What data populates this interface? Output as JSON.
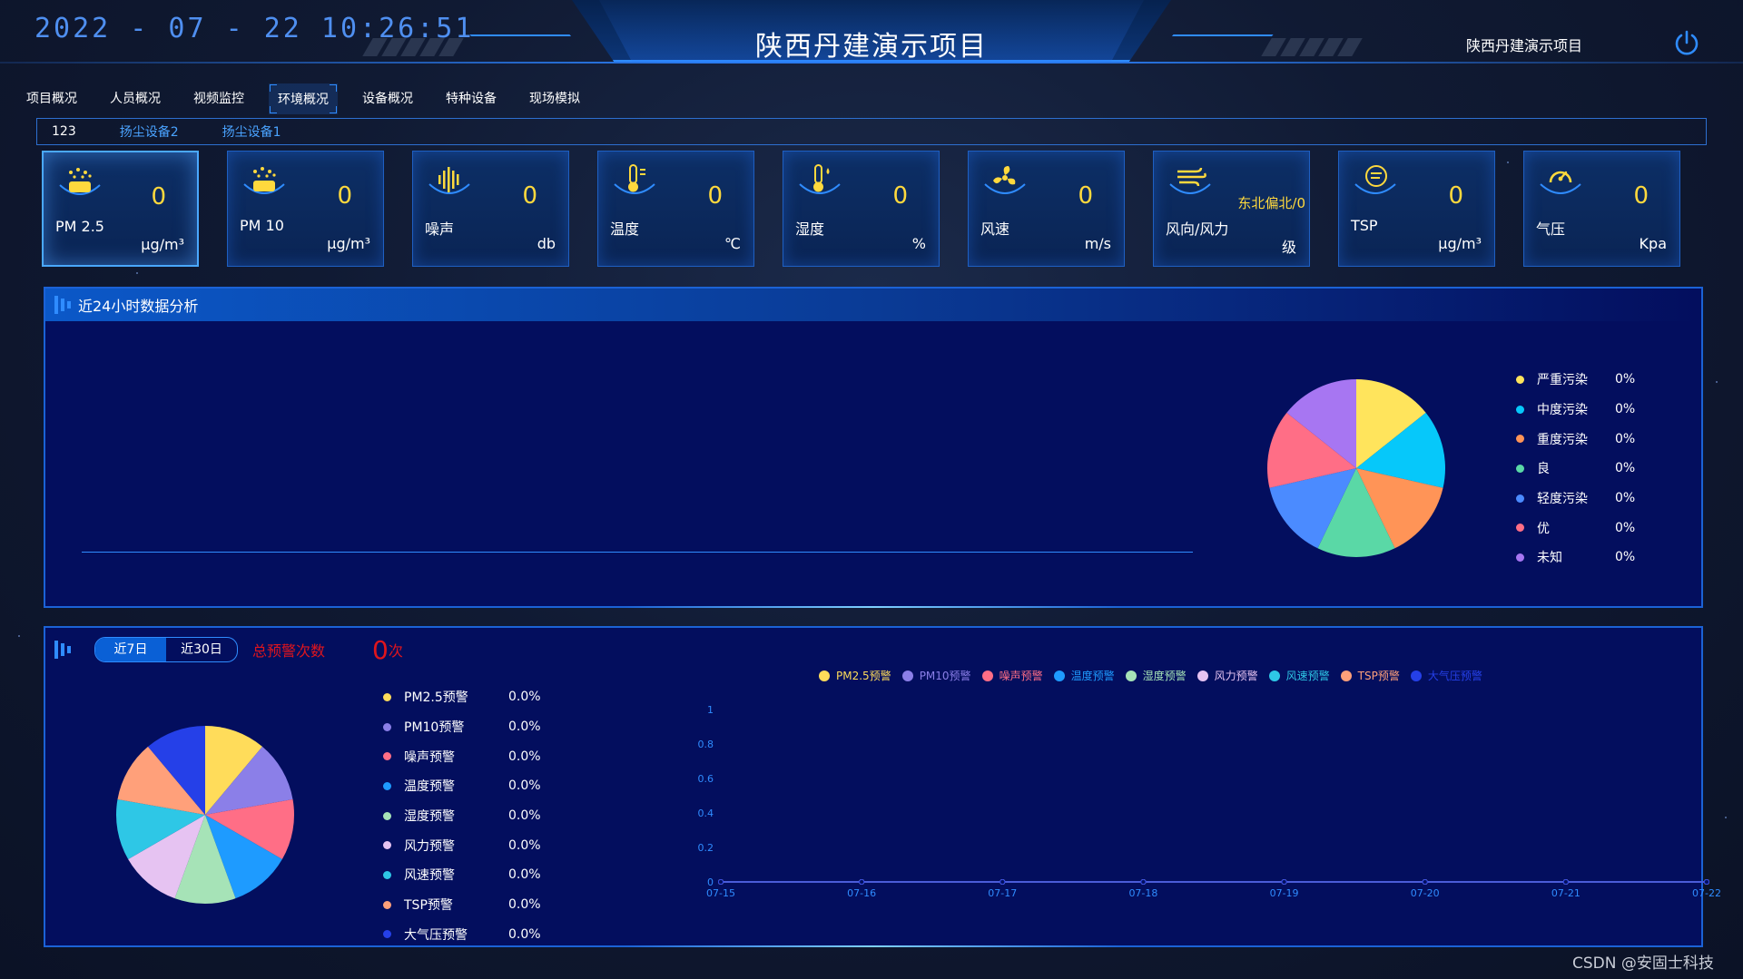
{
  "header": {
    "datetime": "2022 - 07 - 22 10:26:51",
    "title": "陕西丹建演示项目",
    "project_name": "陕西丹建演示项目",
    "power_icon": "power-icon"
  },
  "nav": {
    "items": [
      {
        "label": "项目概况"
      },
      {
        "label": "人员概况"
      },
      {
        "label": "视频监控"
      },
      {
        "label": "环境概况",
        "active": true
      },
      {
        "label": "设备概况"
      },
      {
        "label": "特种设备"
      },
      {
        "label": "现场模拟"
      }
    ]
  },
  "device_tabs": [
    {
      "label": "123",
      "active": true
    },
    {
      "label": "扬尘设备2"
    },
    {
      "label": "扬尘设备1"
    }
  ],
  "cards": [
    {
      "label": "PM 2.5",
      "value": "0",
      "unit": "μg/m³",
      "icon": "pm25-icon"
    },
    {
      "label": "PM 10",
      "value": "0",
      "unit": "μg/m³",
      "icon": "pm10-icon"
    },
    {
      "label": "噪声",
      "value": "0",
      "unit": "db",
      "icon": "noise-icon"
    },
    {
      "label": "温度",
      "value": "0",
      "unit": "℃",
      "icon": "thermometer-icon"
    },
    {
      "label": "湿度",
      "value": "0",
      "unit": "%",
      "icon": "humidity-icon"
    },
    {
      "label": "风速",
      "value": "0",
      "unit": "m/s",
      "icon": "fan-icon"
    },
    {
      "label": "风向/风力",
      "value": "东北偏北/0",
      "unit": "级",
      "icon": "wind-icon"
    },
    {
      "label": "TSP",
      "value": "0",
      "unit": "μg/m³",
      "icon": "tsp-icon"
    },
    {
      "label": "气压",
      "value": "0",
      "unit": "Kpa",
      "icon": "gauge-icon"
    }
  ],
  "panel_24h": {
    "title": "近24小时数据分析",
    "legend": [
      {
        "name": "严重污染",
        "value": "0%",
        "color": "#ffe45c"
      },
      {
        "name": "中度污染",
        "value": "0%",
        "color": "#06c8fa"
      },
      {
        "name": "重度污染",
        "value": "0%",
        "color": "#ff9457"
      },
      {
        "name": "良",
        "value": "0%",
        "color": "#5ad8a6"
      },
      {
        "name": "轻度污染",
        "value": "0%",
        "color": "#4b8bff"
      },
      {
        "name": "优",
        "value": "0%",
        "color": "#ff6e86"
      },
      {
        "name": "未知",
        "value": "0%",
        "color": "#a776f2"
      }
    ]
  },
  "panel_alarm": {
    "range_tabs": [
      {
        "label": "近7日",
        "active": true
      },
      {
        "label": "近30日"
      }
    ],
    "total_label": "总预警次数",
    "total_value": "0",
    "total_unit": "次",
    "legend": [
      {
        "name": "PM2.5预警",
        "value": "0.0%",
        "color": "#ffdc5a"
      },
      {
        "name": "PM10预警",
        "value": "0.0%",
        "color": "#8b7fe8"
      },
      {
        "name": "噪声预警",
        "value": "0.0%",
        "color": "#ff6e86"
      },
      {
        "name": "温度预警",
        "value": "0.0%",
        "color": "#1e9bff"
      },
      {
        "name": "湿度预警",
        "value": "0.0%",
        "color": "#a6e3b7"
      },
      {
        "name": "风力预警",
        "value": "0.0%",
        "color": "#e6c3f2"
      },
      {
        "name": "风速预警",
        "value": "0.0%",
        "color": "#2ec7e6"
      },
      {
        "name": "TSP预警",
        "value": "0.0%",
        "color": "#ffa07a"
      },
      {
        "name": "大气压预警",
        "value": "0.0%",
        "color": "#2540e8"
      }
    ]
  },
  "chart_data": [
    {
      "type": "pie",
      "categories": [
        "严重污染",
        "中度污染",
        "重度污染",
        "良",
        "轻度污染",
        "优",
        "未知"
      ],
      "values": [
        1,
        1,
        1,
        1,
        1,
        1,
        1
      ]
    },
    {
      "type": "pie",
      "categories": [
        "PM2.5预警",
        "PM10预警",
        "噪声预警",
        "温度预警",
        "湿度预警",
        "风力预警",
        "风速预警",
        "TSP预警",
        "大气压预警"
      ],
      "values": [
        1,
        1,
        1,
        1,
        1,
        1,
        1,
        1,
        1
      ]
    },
    {
      "type": "line",
      "x": [
        "07-15",
        "07-16",
        "07-17",
        "07-18",
        "07-19",
        "07-20",
        "07-21",
        "07-22"
      ],
      "ylim": [
        0,
        1
      ],
      "yticks": [
        "0",
        "0.2",
        "0.4",
        "0.6",
        "0.8",
        "1"
      ],
      "series": [
        {
          "name": "PM2.5预警",
          "color": "#ffdc5a",
          "values": [
            0,
            0,
            0,
            0,
            0,
            0,
            0,
            0
          ]
        },
        {
          "name": "PM10预警",
          "color": "#8b7fe8",
          "values": [
            0,
            0,
            0,
            0,
            0,
            0,
            0,
            0
          ]
        },
        {
          "name": "噪声预警",
          "color": "#ff6e86",
          "values": [
            0,
            0,
            0,
            0,
            0,
            0,
            0,
            0
          ]
        },
        {
          "name": "温度预警",
          "color": "#1e9bff",
          "values": [
            0,
            0,
            0,
            0,
            0,
            0,
            0,
            0
          ]
        },
        {
          "name": "湿度预警",
          "color": "#a6e3b7",
          "values": [
            0,
            0,
            0,
            0,
            0,
            0,
            0,
            0
          ]
        },
        {
          "name": "风力预警",
          "color": "#e6c3f2",
          "values": [
            0,
            0,
            0,
            0,
            0,
            0,
            0,
            0
          ]
        },
        {
          "name": "风速预警",
          "color": "#2ec7e6",
          "values": [
            0,
            0,
            0,
            0,
            0,
            0,
            0,
            0
          ]
        },
        {
          "name": "TSP预警",
          "color": "#ffa07a",
          "values": [
            0,
            0,
            0,
            0,
            0,
            0,
            0,
            0
          ]
        },
        {
          "name": "大气压预警",
          "color": "#2540e8",
          "values": [
            0,
            0,
            0,
            0,
            0,
            0,
            0,
            0
          ]
        }
      ]
    }
  ],
  "watermark": "CSDN @安固士科技"
}
